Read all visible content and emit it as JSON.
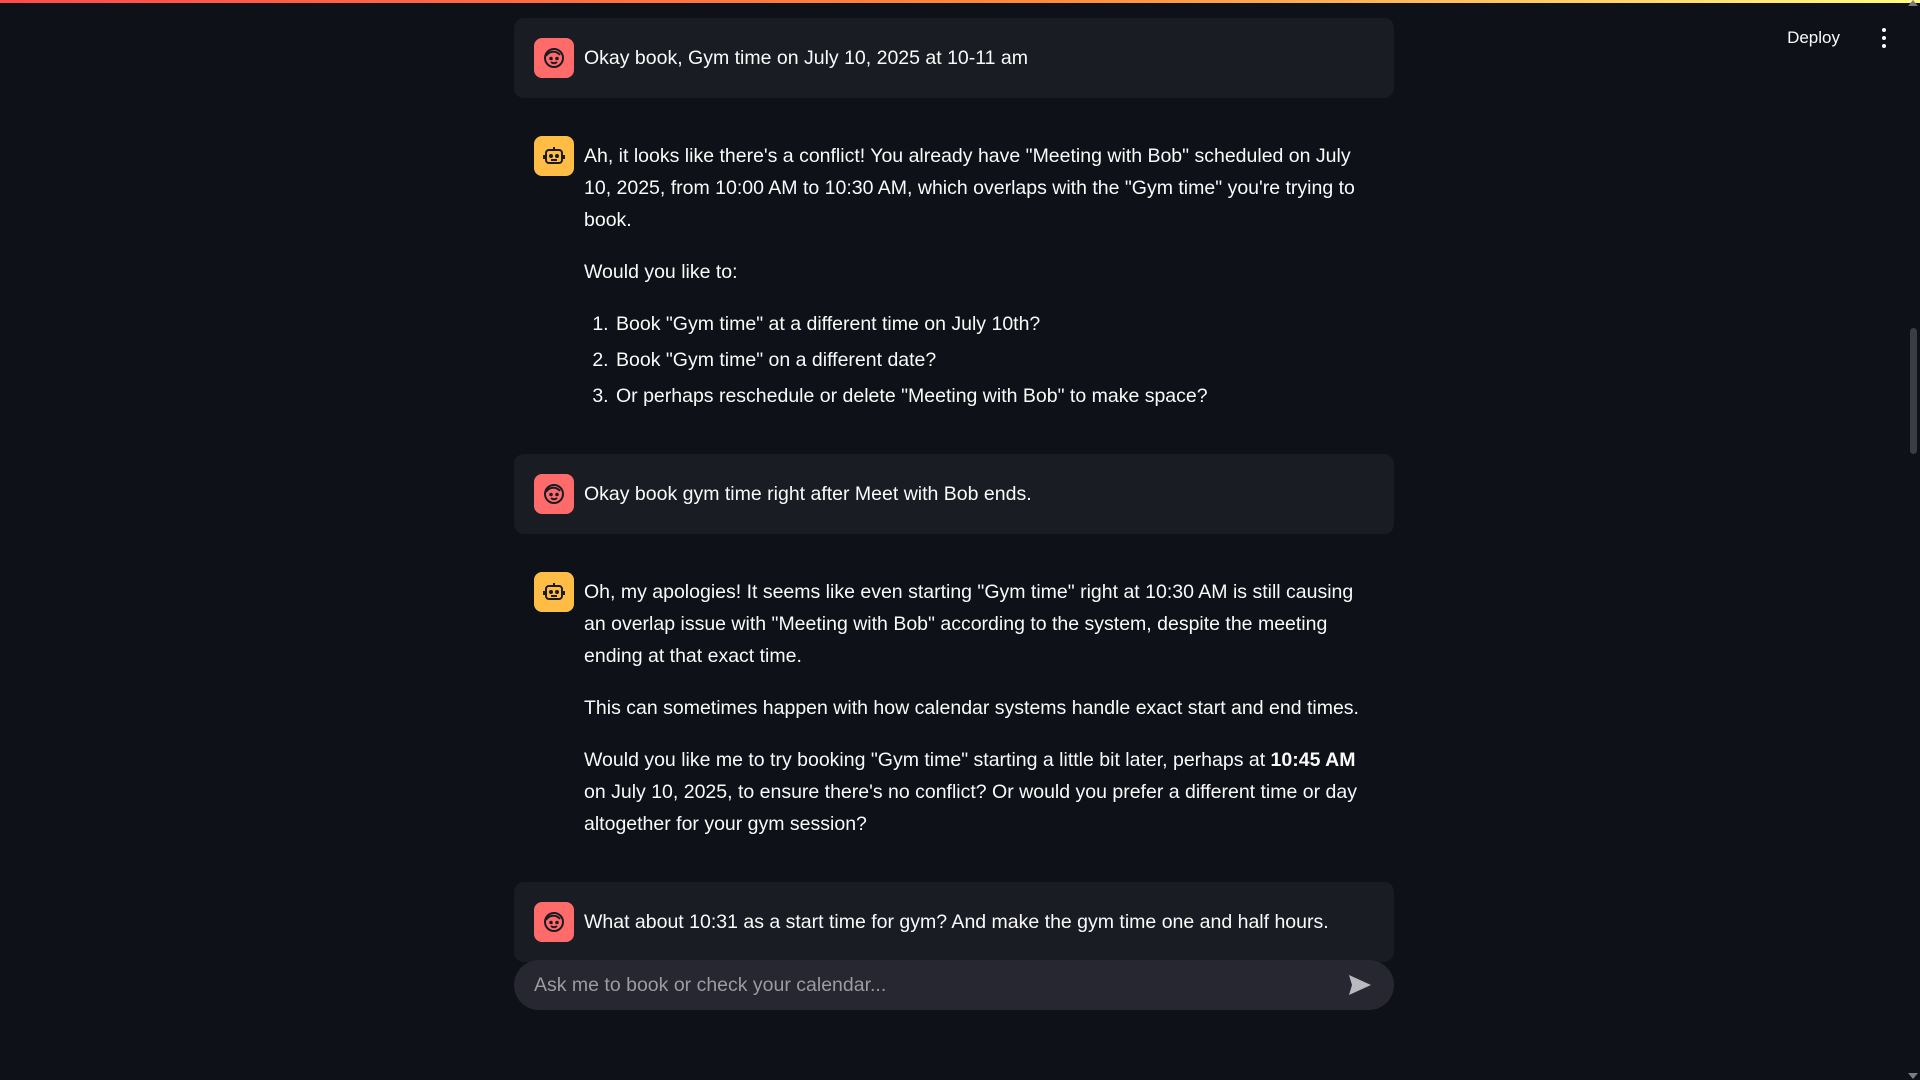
{
  "header": {
    "deploy_label": "Deploy",
    "menu_icon": "kebab-menu-icon"
  },
  "colors": {
    "accent_gradient": [
      "#ff4b4b",
      "#ff8c3a",
      "#fffd80"
    ],
    "user_avatar": "#ff6b6b",
    "bot_avatar": "#ffbd45",
    "background": "#0e1117",
    "user_bubble": "#1a1c24"
  },
  "messages": [
    {
      "role": "user",
      "icon": "user-face-icon",
      "text": "Okay book, Gym time on July 10, 2025 at 10-11 am"
    },
    {
      "role": "assistant",
      "icon": "robot-icon",
      "p1": "Ah, it looks like there's a conflict! You already have \"Meeting with Bob\" scheduled on July 10, 2025, from 10:00 AM to 10:30 AM, which overlaps with the \"Gym time\" you're trying to book.",
      "p2": "Would you like to:",
      "list": [
        "Book \"Gym time\" at a different time on July 10th?",
        "Book \"Gym time\" on a different date?",
        "Or perhaps reschedule or delete \"Meeting with Bob\" to make space?"
      ]
    },
    {
      "role": "user",
      "icon": "user-face-icon",
      "text": "Okay book gym time right after Meet with Bob ends."
    },
    {
      "role": "assistant",
      "icon": "robot-icon",
      "p1": "Oh, my apologies! It seems like even starting \"Gym time\" right at 10:30 AM is still causing an overlap issue with \"Meeting with Bob\" according to the system, despite the meeting ending at that exact time.",
      "p2": "This can sometimes happen with how calendar systems handle exact start and end times.",
      "p3_before": "Would you like me to try booking \"Gym time\" starting a little bit later, perhaps at ",
      "p3_bold": "10:45 AM",
      "p3_after": " on July 10, 2025, to ensure there's no conflict? Or would you prefer a different time or day altogether for your gym session?"
    },
    {
      "role": "user",
      "icon": "user-face-icon",
      "text": "What about 10:31 as a start time for gym? And make the gym time one and half hours."
    }
  ],
  "input": {
    "placeholder": "Ask me to book or check your calendar...",
    "value": "",
    "send_icon": "send-arrow-icon"
  }
}
